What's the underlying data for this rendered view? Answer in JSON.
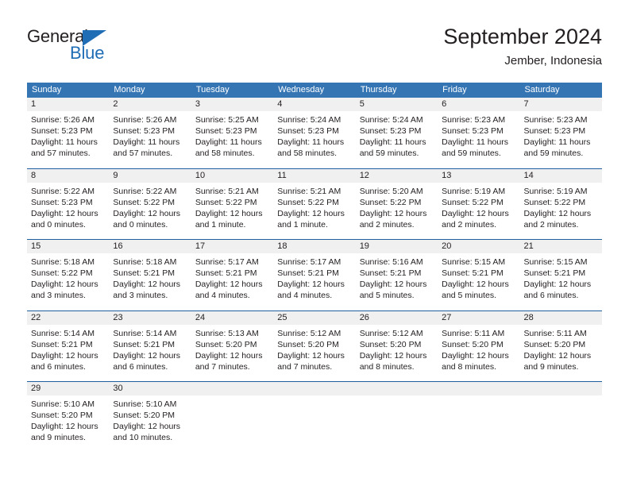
{
  "brand": {
    "name_part1": "General",
    "name_part2": "Blue",
    "accent_color": "#1f6db5"
  },
  "header": {
    "title": "September 2024",
    "subtitle": "Jember, Indonesia"
  },
  "theme": {
    "header_row_bg": "#3575b4",
    "daynum_bg": "#f0f0f0",
    "separator": "#1f5fa0",
    "text": "#231f20"
  },
  "weekdays": [
    "Sunday",
    "Monday",
    "Tuesday",
    "Wednesday",
    "Thursday",
    "Friday",
    "Saturday"
  ],
  "weeks": [
    {
      "daynums": [
        "1",
        "2",
        "3",
        "4",
        "5",
        "6",
        "7"
      ],
      "cells": [
        {
          "sunrise": "Sunrise: 5:26 AM",
          "sunset": "Sunset: 5:23 PM",
          "daylight": "Daylight: 11 hours and 57 minutes."
        },
        {
          "sunrise": "Sunrise: 5:26 AM",
          "sunset": "Sunset: 5:23 PM",
          "daylight": "Daylight: 11 hours and 57 minutes."
        },
        {
          "sunrise": "Sunrise: 5:25 AM",
          "sunset": "Sunset: 5:23 PM",
          "daylight": "Daylight: 11 hours and 58 minutes."
        },
        {
          "sunrise": "Sunrise: 5:24 AM",
          "sunset": "Sunset: 5:23 PM",
          "daylight": "Daylight: 11 hours and 58 minutes."
        },
        {
          "sunrise": "Sunrise: 5:24 AM",
          "sunset": "Sunset: 5:23 PM",
          "daylight": "Daylight: 11 hours and 59 minutes."
        },
        {
          "sunrise": "Sunrise: 5:23 AM",
          "sunset": "Sunset: 5:23 PM",
          "daylight": "Daylight: 11 hours and 59 minutes."
        },
        {
          "sunrise": "Sunrise: 5:23 AM",
          "sunset": "Sunset: 5:23 PM",
          "daylight": "Daylight: 11 hours and 59 minutes."
        }
      ]
    },
    {
      "daynums": [
        "8",
        "9",
        "10",
        "11",
        "12",
        "13",
        "14"
      ],
      "cells": [
        {
          "sunrise": "Sunrise: 5:22 AM",
          "sunset": "Sunset: 5:23 PM",
          "daylight": "Daylight: 12 hours and 0 minutes."
        },
        {
          "sunrise": "Sunrise: 5:22 AM",
          "sunset": "Sunset: 5:22 PM",
          "daylight": "Daylight: 12 hours and 0 minutes."
        },
        {
          "sunrise": "Sunrise: 5:21 AM",
          "sunset": "Sunset: 5:22 PM",
          "daylight": "Daylight: 12 hours and 1 minute."
        },
        {
          "sunrise": "Sunrise: 5:21 AM",
          "sunset": "Sunset: 5:22 PM",
          "daylight": "Daylight: 12 hours and 1 minute."
        },
        {
          "sunrise": "Sunrise: 5:20 AM",
          "sunset": "Sunset: 5:22 PM",
          "daylight": "Daylight: 12 hours and 2 minutes."
        },
        {
          "sunrise": "Sunrise: 5:19 AM",
          "sunset": "Sunset: 5:22 PM",
          "daylight": "Daylight: 12 hours and 2 minutes."
        },
        {
          "sunrise": "Sunrise: 5:19 AM",
          "sunset": "Sunset: 5:22 PM",
          "daylight": "Daylight: 12 hours and 2 minutes."
        }
      ]
    },
    {
      "daynums": [
        "15",
        "16",
        "17",
        "18",
        "19",
        "20",
        "21"
      ],
      "cells": [
        {
          "sunrise": "Sunrise: 5:18 AM",
          "sunset": "Sunset: 5:22 PM",
          "daylight": "Daylight: 12 hours and 3 minutes."
        },
        {
          "sunrise": "Sunrise: 5:18 AM",
          "sunset": "Sunset: 5:21 PM",
          "daylight": "Daylight: 12 hours and 3 minutes."
        },
        {
          "sunrise": "Sunrise: 5:17 AM",
          "sunset": "Sunset: 5:21 PM",
          "daylight": "Daylight: 12 hours and 4 minutes."
        },
        {
          "sunrise": "Sunrise: 5:17 AM",
          "sunset": "Sunset: 5:21 PM",
          "daylight": "Daylight: 12 hours and 4 minutes."
        },
        {
          "sunrise": "Sunrise: 5:16 AM",
          "sunset": "Sunset: 5:21 PM",
          "daylight": "Daylight: 12 hours and 5 minutes."
        },
        {
          "sunrise": "Sunrise: 5:15 AM",
          "sunset": "Sunset: 5:21 PM",
          "daylight": "Daylight: 12 hours and 5 minutes."
        },
        {
          "sunrise": "Sunrise: 5:15 AM",
          "sunset": "Sunset: 5:21 PM",
          "daylight": "Daylight: 12 hours and 6 minutes."
        }
      ]
    },
    {
      "daynums": [
        "22",
        "23",
        "24",
        "25",
        "26",
        "27",
        "28"
      ],
      "cells": [
        {
          "sunrise": "Sunrise: 5:14 AM",
          "sunset": "Sunset: 5:21 PM",
          "daylight": "Daylight: 12 hours and 6 minutes."
        },
        {
          "sunrise": "Sunrise: 5:14 AM",
          "sunset": "Sunset: 5:21 PM",
          "daylight": "Daylight: 12 hours and 6 minutes."
        },
        {
          "sunrise": "Sunrise: 5:13 AM",
          "sunset": "Sunset: 5:20 PM",
          "daylight": "Daylight: 12 hours and 7 minutes."
        },
        {
          "sunrise": "Sunrise: 5:12 AM",
          "sunset": "Sunset: 5:20 PM",
          "daylight": "Daylight: 12 hours and 7 minutes."
        },
        {
          "sunrise": "Sunrise: 5:12 AM",
          "sunset": "Sunset: 5:20 PM",
          "daylight": "Daylight: 12 hours and 8 minutes."
        },
        {
          "sunrise": "Sunrise: 5:11 AM",
          "sunset": "Sunset: 5:20 PM",
          "daylight": "Daylight: 12 hours and 8 minutes."
        },
        {
          "sunrise": "Sunrise: 5:11 AM",
          "sunset": "Sunset: 5:20 PM",
          "daylight": "Daylight: 12 hours and 9 minutes."
        }
      ]
    },
    {
      "daynums": [
        "29",
        "30",
        "",
        "",
        "",
        "",
        ""
      ],
      "cells": [
        {
          "sunrise": "Sunrise: 5:10 AM",
          "sunset": "Sunset: 5:20 PM",
          "daylight": "Daylight: 12 hours and 9 minutes."
        },
        {
          "sunrise": "Sunrise: 5:10 AM",
          "sunset": "Sunset: 5:20 PM",
          "daylight": "Daylight: 12 hours and 10 minutes."
        },
        {
          "sunrise": "",
          "sunset": "",
          "daylight": ""
        },
        {
          "sunrise": "",
          "sunset": "",
          "daylight": ""
        },
        {
          "sunrise": "",
          "sunset": "",
          "daylight": ""
        },
        {
          "sunrise": "",
          "sunset": "",
          "daylight": ""
        },
        {
          "sunrise": "",
          "sunset": "",
          "daylight": ""
        }
      ]
    }
  ]
}
